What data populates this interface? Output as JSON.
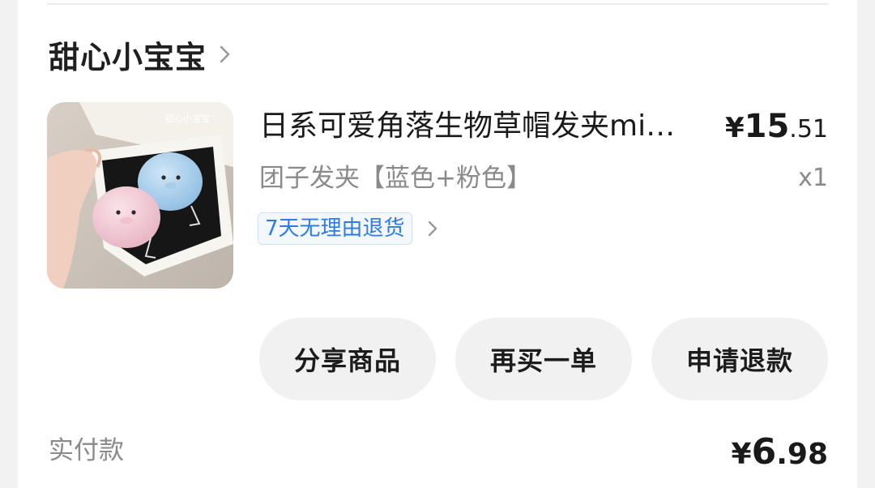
{
  "shop": {
    "name": "甜心小宝宝"
  },
  "product": {
    "title": "日系可爱角落生物草帽发夹mi…",
    "image_icon": "product-thumbnail",
    "image_caption": "甜心小宝宝",
    "price_symbol": "¥",
    "price_int": "15",
    "price_dec": ".51",
    "variant": "团子发夹【蓝色+粉色】",
    "quantity": "x1",
    "return_policy": "7天无理由退货"
  },
  "actions": {
    "share_label": "分享商品",
    "rebuy_label": "再买一单",
    "refund_label": "申请退款"
  },
  "payment": {
    "label": "实付款",
    "symbol": "¥",
    "int": "6",
    "dec": ".98"
  },
  "colors": {
    "accent": "#2e7ae6",
    "button_bg": "#f1f1f1",
    "muted_text": "#8a8a8a"
  }
}
